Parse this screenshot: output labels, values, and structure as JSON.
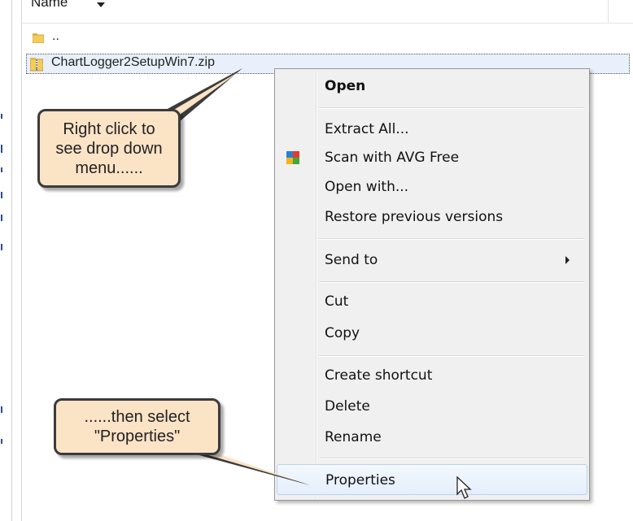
{
  "header": {
    "column_name": "Name"
  },
  "files": [
    {
      "label": "..",
      "icon": "folder-up-icon"
    },
    {
      "label": "ChartLogger2SetupWin7.zip",
      "icon": "zip-folder-icon"
    }
  ],
  "context_menu": {
    "items": [
      {
        "label": "Open"
      },
      {
        "label": "Extract All..."
      },
      {
        "label": "Scan with AVG Free",
        "icon": "avg-icon"
      },
      {
        "label": "Open with..."
      },
      {
        "label": "Restore previous versions"
      },
      {
        "label": "Send to"
      },
      {
        "label": "Cut"
      },
      {
        "label": "Copy"
      },
      {
        "label": "Create shortcut"
      },
      {
        "label": "Delete"
      },
      {
        "label": "Rename"
      },
      {
        "label": "Properties"
      }
    ]
  },
  "callouts": {
    "first": {
      "lines": [
        "Right click to",
        "see drop down",
        "menu......"
      ]
    },
    "second": {
      "lines": [
        "......then select",
        "\"Properties\""
      ]
    }
  },
  "colors": {
    "callout_fill": "#fbe3c6",
    "menu_bg": "#f0f0f0",
    "selection": "#e8f0fb"
  }
}
